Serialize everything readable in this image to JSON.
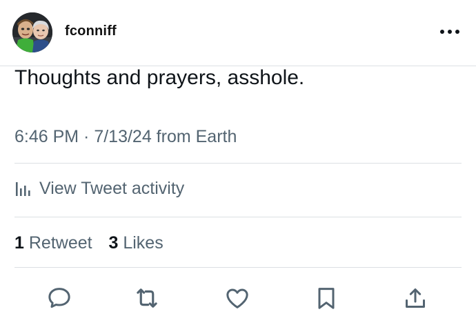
{
  "author": {
    "username": "fconniff",
    "avatar_icon": "profile-photo-two-faces",
    "more_icon": "more-dots-icon"
  },
  "tweet": {
    "text": "Thoughts and prayers, asshole.",
    "meta": "6:46 PM · 7/13/24 from Earth"
  },
  "activity": {
    "icon": "bar-chart-icon",
    "label": "View Tweet activity"
  },
  "stats": {
    "retweets_count": "1",
    "retweets_label": "Retweet",
    "likes_count": "3",
    "likes_label": "Likes"
  },
  "actions": [
    {
      "name": "reply",
      "icon": "speech-bubble-icon"
    },
    {
      "name": "retweet",
      "icon": "retweet-arrows-icon"
    },
    {
      "name": "like",
      "icon": "heart-icon"
    },
    {
      "name": "bookmark",
      "icon": "bookmark-icon"
    },
    {
      "name": "share",
      "icon": "share-upload-icon"
    }
  ],
  "colors": {
    "text": "#0f1419",
    "secondary": "#536471",
    "divider": "#dcdfe3",
    "background": "#ffffff"
  }
}
